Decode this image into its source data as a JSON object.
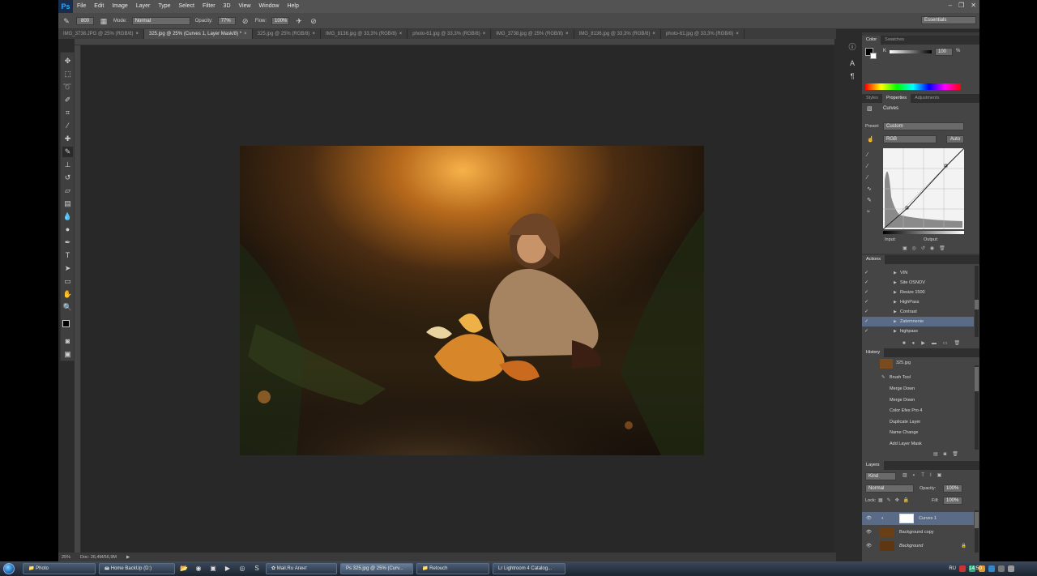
{
  "app": {
    "logo": "Ps",
    "menu": [
      "File",
      "Edit",
      "Image",
      "Layer",
      "Type",
      "Select",
      "Filter",
      "3D",
      "View",
      "Window",
      "Help"
    ],
    "window_controls": [
      "–",
      "❐",
      "✕"
    ]
  },
  "options_bar": {
    "brush_size": "800",
    "mode_label": "Mode:",
    "mode_value": "Normal",
    "opacity_label": "Opacity:",
    "opacity_value": "77%",
    "flow_label": "Flow:",
    "flow_value": "100%",
    "workspace": "Essentials"
  },
  "tabs": [
    {
      "label": "IMG_3738.JPG @ 25% (RGB/8)",
      "active": false
    },
    {
      "label": "325.jpg @ 25% (Curves 1, Layer Mask/8) *",
      "active": true
    },
    {
      "label": "325.jpg @ 25% (RGB/8)",
      "active": false
    },
    {
      "label": "IMG_8136.jpg @ 33,3% (RGB/8)",
      "active": false
    },
    {
      "label": "photo-61.jpg @ 33,3% (RGB/8)",
      "active": false
    },
    {
      "label": "IMG_3738.jpg @ 25% (RGB/8)",
      "active": false
    },
    {
      "label": "IMG_8136.jpg @ 33,3% (RGB/8)",
      "active": false
    },
    {
      "label": "photo-61.jpg @ 33,3% (RGB/8)",
      "active": false
    }
  ],
  "status": {
    "zoom": "25%",
    "doc": "Doc: 26,4M/56,9M"
  },
  "color_panel": {
    "tabs": [
      "Color",
      "Swatches"
    ],
    "channel": "K",
    "value": "100",
    "unit": "%"
  },
  "properties_panel": {
    "tabs": [
      "Styles",
      "Properties",
      "Adjustments"
    ],
    "title": "Curves",
    "preset_label": "Preset:",
    "preset_value": "Custom",
    "channel": "RGB",
    "auto": "Auto",
    "input_label": "Input:",
    "output_label": "Output:"
  },
  "actions_panel": {
    "tab": "Actions",
    "items": [
      {
        "label": "VIN",
        "selected": false
      },
      {
        "label": "Site OSNOV",
        "selected": false
      },
      {
        "label": "Resize 1500",
        "selected": false
      },
      {
        "label": "HighPass",
        "selected": false
      },
      {
        "label": "Contrast",
        "selected": false
      },
      {
        "label": "Zatemnenie",
        "selected": true
      },
      {
        "label": "highpass",
        "selected": false
      }
    ]
  },
  "history_panel": {
    "tab": "History",
    "snapshot": "325.jpg",
    "items": [
      "Brush Tool",
      "Merge Down",
      "Merge Down",
      "Color Efex Pro 4",
      "Duplicate Layer",
      "Name Change",
      "Add Layer Mask"
    ]
  },
  "layers_panel": {
    "tab": "Layers",
    "kind": "Kind",
    "blend": "Normal",
    "opacity_label": "Opacity:",
    "opacity_value": "100%",
    "lock_label": "Lock:",
    "fill_label": "Fill:",
    "fill_value": "100%",
    "layers": [
      {
        "name": "Curves 1",
        "selected": true
      },
      {
        "name": "Background copy",
        "selected": false
      },
      {
        "name": "Background",
        "selected": false
      }
    ]
  },
  "taskbar": {
    "buttons": [
      {
        "label": "Photo",
        "active": false
      },
      {
        "label": "Home BackUp (D:)",
        "active": false
      },
      {
        "label": "Mail.Ru Агент",
        "active": false
      },
      {
        "label": "325.jpg @ 25% (Curv...",
        "active": true
      },
      {
        "label": "Retouch",
        "active": false
      },
      {
        "label": "Lightroom 4 Catalog...",
        "active": false
      }
    ],
    "lang": "RU",
    "time": "14:50"
  },
  "colors": {
    "accent_blue": "#31a8ff",
    "selection": "#5a6b87",
    "panel_bg": "#454545"
  }
}
